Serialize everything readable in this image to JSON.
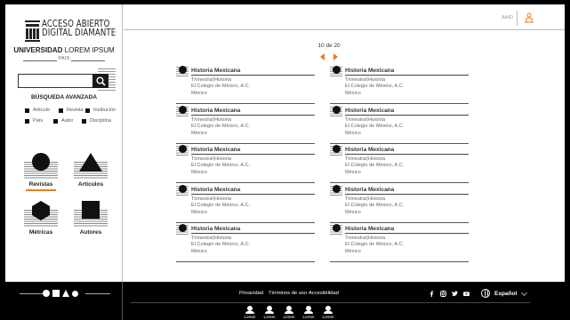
{
  "branding": {
    "logo_line1": "ACCESO ABIERTO",
    "logo_line2": "DIGITAL DIAMANTE",
    "university_bold": "UNIVERSIDAD",
    "university_rest": "LOREM IPSUM",
    "country": "PAIS"
  },
  "search": {
    "placeholder": "",
    "advanced_label": "BÚSQUEDA AVANZADA"
  },
  "filters": [
    {
      "label": "Artículo"
    },
    {
      "label": "Revista"
    },
    {
      "label": "Institución"
    },
    {
      "label": "País"
    },
    {
      "label": "Autor"
    },
    {
      "label": "Disciplina"
    }
  ],
  "categories": [
    {
      "label": "Revistas",
      "icon": "circle-icon",
      "active": true
    },
    {
      "label": "Artículos",
      "icon": "triangle-icon",
      "active": false
    },
    {
      "label": "Métricas",
      "icon": "hexagon-icon",
      "active": false
    },
    {
      "label": "Autores",
      "icon": "square-icon",
      "active": false
    }
  ],
  "topbar": {
    "user_label": "AAID",
    "icon": "person-network-icon"
  },
  "pagination": {
    "text": "10 de 20"
  },
  "results": [
    {
      "title": "Historia Mexicana",
      "frequency": "Trimestral",
      "discipline": "Historia",
      "publisher": "El Colegio de México, A.C.",
      "country": "México"
    },
    {
      "title": "Historia Mexicana",
      "frequency": "Trimestral",
      "discipline": "Historia",
      "publisher": "El Colegio de México, A.C.",
      "country": "México"
    },
    {
      "title": "Historia Mexicana",
      "frequency": "Trimestral",
      "discipline": "Historia",
      "publisher": "El Colegio de México, A.C.",
      "country": "México"
    },
    {
      "title": "Historia Mexicana",
      "frequency": "Trimestral",
      "discipline": "Historia",
      "publisher": "El Colegio de México, A.C.",
      "country": "México"
    },
    {
      "title": "Historia Mexicana",
      "frequency": "Trimestral",
      "discipline": "Historia",
      "publisher": "El Colegio de México, A.C.",
      "country": "México"
    },
    {
      "title": "Historia Mexicana",
      "frequency": "Trimestral",
      "discipline": "Historia",
      "publisher": "El Colegio de México, A.C.",
      "country": "México"
    },
    {
      "title": "Historia Mexicana",
      "frequency": "Trimestral",
      "discipline": "Historia",
      "publisher": "El Colegio de México, A.C.",
      "country": "México"
    },
    {
      "title": "Historia Mexicana",
      "frequency": "Trimestral",
      "discipline": "Historia",
      "publisher": "El Colegio de México, A.C.",
      "country": "México"
    },
    {
      "title": "Historia Mexicana",
      "frequency": "Trimestral",
      "discipline": "Historia",
      "publisher": "El Colegio de México, A.C.",
      "country": "México"
    },
    {
      "title": "Historia Mexicana",
      "frequency": "Trimestral",
      "discipline": "Historia",
      "publisher": "El Colegio de México, A.C.",
      "country": "México"
    }
  ],
  "footer": {
    "links": [
      {
        "label": "Privacidad"
      },
      {
        "label": "Términos de uso"
      },
      {
        "label": "Accesibilidad"
      }
    ],
    "social": [
      "facebook-icon",
      "instagram-icon",
      "twitter-icon",
      "youtube-icon"
    ],
    "language": "Español",
    "users": [
      {
        "label": "Lorem"
      },
      {
        "label": "Lorem"
      },
      {
        "label": "Lorem"
      },
      {
        "label": "Lorem"
      },
      {
        "label": "Lorem"
      }
    ]
  },
  "colors": {
    "accent": "#e87d22",
    "dark": "#111111",
    "background": "#000000"
  }
}
